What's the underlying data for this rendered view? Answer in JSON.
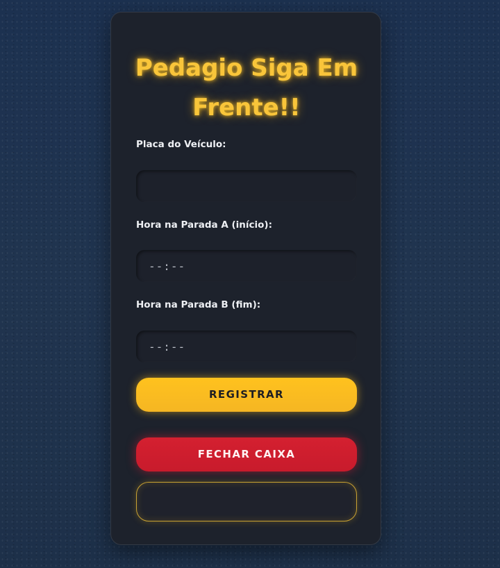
{
  "app": {
    "title": "Pedagio Siga Em Frente!!"
  },
  "form": {
    "plate": {
      "label": "Placa do Veículo:",
      "value": ""
    },
    "stop_a": {
      "label": "Hora na Parada A (início):",
      "value": "--:--"
    },
    "stop_b": {
      "label": "Hora na Parada B (fim):",
      "value": "--:--"
    }
  },
  "buttons": {
    "register_label": "REGISTRAR",
    "close_label": "FECHAR CAIXA"
  },
  "result": {
    "text": ""
  },
  "colors": {
    "accent": "#f9c53a",
    "danger": "#d42030",
    "card": "#1d222c",
    "background": "#1f3350"
  }
}
